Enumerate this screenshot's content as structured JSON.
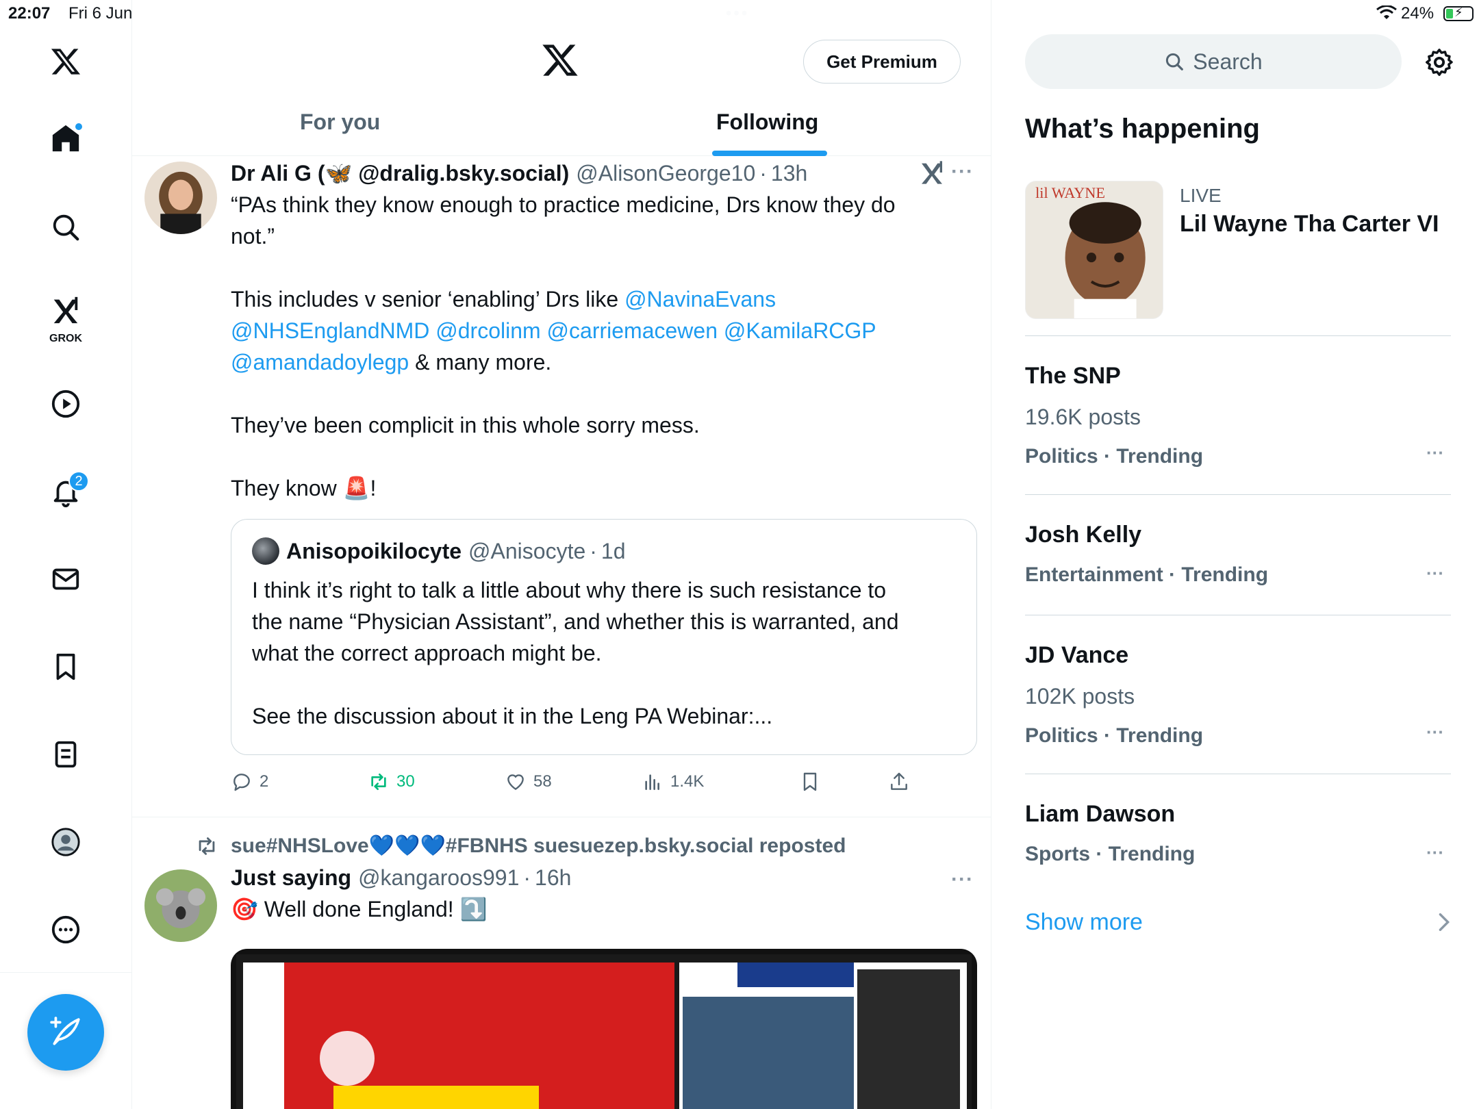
{
  "status_bar": {
    "time": "22:07",
    "date": "Fri 6 Jun",
    "battery": "24%",
    "battery_level": 0.24
  },
  "nav": {
    "grok_label": "GROK",
    "notifications_count": "2"
  },
  "header": {
    "premium_label": "Get Premium",
    "tabs": [
      {
        "label": "For you",
        "active": false
      },
      {
        "label": "Following",
        "active": true
      }
    ]
  },
  "tweet1": {
    "name": "Dr Ali G (🦋 @dralig.bsky.social)",
    "handle": "@AlisonGeorge10",
    "time": "13h",
    "text_line1": "“PAs think they know enough to practice medicine, Drs know they do",
    "text_line2": "not.”",
    "text_p2_pre": "This includes v senior ‘enabling’ Drs like ",
    "mentions": [
      "@NavinaEvans",
      "@NHSEnglandNMD",
      "@drcolinm",
      "@carriemacewen",
      "@KamilaRCGP",
      "@amandadoylegp"
    ],
    "text_p2_post": " & many more.",
    "text_p3": "They’ve been complicit in this whole sorry mess.",
    "text_p4_pre": "They know ",
    "text_p4_emoji": "🚨",
    "text_p4_post": "!",
    "quote": {
      "name": "Anisopoikilocyte",
      "handle": "@Anisocyte",
      "time": "1d",
      "text": "I think it’s right to talk a little about why there is such resistance to\nthe name “Physician Assistant”, and whether this is warranted, and\nwhat the correct approach might be.\n\nSee the discussion about it in the Leng PA Webinar:..."
    },
    "actions": {
      "replies": "2",
      "reposts": "30",
      "likes": "58",
      "views": "1.4K"
    }
  },
  "tweet2": {
    "repost_line": "sue#NHSLove💙💙💙#FBNHS suesuezep.bsky.social reposted",
    "name": "Just saying",
    "handle": "@kangaroos991",
    "time": "16h",
    "text_emoji": "🎯",
    "text": " Well done England! ",
    "text_emoji2": "⤵️"
  },
  "sidebar": {
    "search_placeholder": "Search",
    "section_title": "What’s happening",
    "live": {
      "label": "LIVE",
      "title": "Lil Wayne Tha Carter VI",
      "album_text": "lil WAYNE"
    },
    "trends": [
      {
        "name": "The SNP",
        "posts": "19.6K posts",
        "category": "Politics · Trending"
      },
      {
        "name": "Josh Kelly",
        "posts": "",
        "category": "Entertainment · Trending"
      },
      {
        "name": "JD Vance",
        "posts": "102K posts",
        "category": "Politics · Trending"
      },
      {
        "name": "Liam Dawson",
        "posts": "",
        "category": "Sports · Trending"
      }
    ],
    "show_more": "Show more"
  },
  "colors": {
    "accent": "#1d9bf0",
    "repost_green": "#00ba7c",
    "text": "#0f1419",
    "muted": "#536471"
  }
}
